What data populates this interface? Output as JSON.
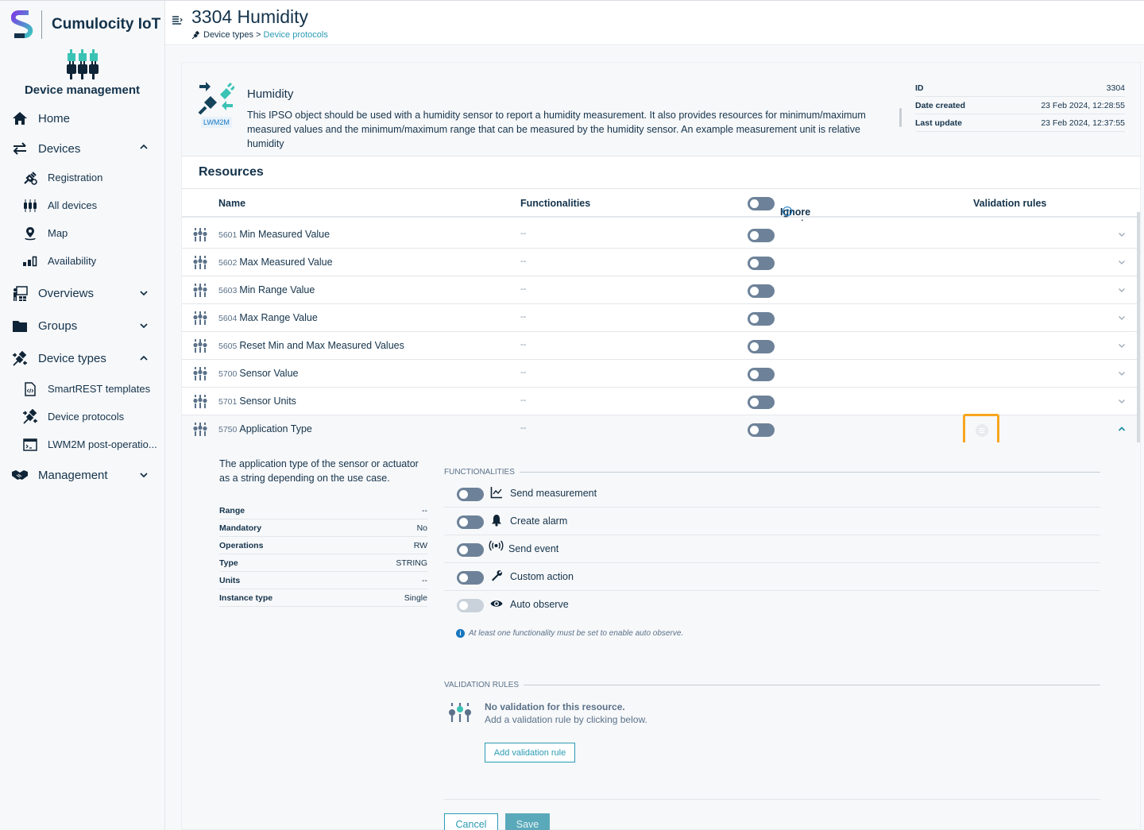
{
  "brand": {
    "name": "Cumulocity IoT",
    "app_name": "Device management"
  },
  "sidebar": {
    "items": [
      {
        "label": "Home",
        "icon": "home-icon"
      },
      {
        "label": "Devices",
        "icon": "devices-arrows-icon",
        "expanded": true,
        "children": [
          {
            "label": "Registration",
            "icon": "plug-add-icon"
          },
          {
            "label": "All devices",
            "icon": "all-devices-icon"
          },
          {
            "label": "Map",
            "icon": "map-pin-icon"
          },
          {
            "label": "Availability",
            "icon": "bars-icon"
          }
        ]
      },
      {
        "label": "Overviews",
        "icon": "presentation-icon",
        "expanded": false
      },
      {
        "label": "Groups",
        "icon": "folder-icon",
        "expanded": false
      },
      {
        "label": "Device types",
        "icon": "plugs-icon",
        "expanded": true,
        "children": [
          {
            "label": "SmartREST templates",
            "icon": "code-file-icon"
          },
          {
            "label": "Device protocols",
            "icon": "plugs-icon"
          },
          {
            "label": "LWM2M post-operatio...",
            "icon": "terminal-icon"
          }
        ]
      },
      {
        "label": "Management",
        "icon": "handshake-icon",
        "expanded": false
      }
    ]
  },
  "header": {
    "title": "3304 Humidity",
    "breadcrumb": {
      "parent": "Device types",
      "separator": ">",
      "current": "Device protocols"
    }
  },
  "object": {
    "name": "Humidity",
    "badge": "LWM2M",
    "description": "This IPSO object should be used with a humidity sensor to report a humidity measurement.  It also provides resources for minimum/maximum measured values and the minimum/maximum range that can be measured by the humidity sensor. An example measurement unit is relative humidity",
    "meta": [
      {
        "key": "ID",
        "value": "3304"
      },
      {
        "key": "Date created",
        "value": "23 Feb 2024, 12:28:55"
      },
      {
        "key": "Last update",
        "value": "23 Feb 2024, 12:37:55"
      }
    ]
  },
  "resources": {
    "title": "Resources",
    "columns": {
      "name": "Name",
      "functionalities": "Functionalities",
      "ignore_empty": "Ignore empty values",
      "validation": "Validation rules"
    },
    "ignore_empty_all": false,
    "rows": [
      {
        "id": "5601",
        "name": "Min Measured Value",
        "functionalities": "--",
        "ignore_empty": false
      },
      {
        "id": "5602",
        "name": "Max Measured Value",
        "functionalities": "--",
        "ignore_empty": false
      },
      {
        "id": "5603",
        "name": "Min Range Value",
        "functionalities": "--",
        "ignore_empty": false
      },
      {
        "id": "5604",
        "name": "Max Range Value",
        "functionalities": "--",
        "ignore_empty": false
      },
      {
        "id": "5605",
        "name": "Reset Min and Max Measured Values",
        "functionalities": "--",
        "ignore_empty": false
      },
      {
        "id": "5700",
        "name": "Sensor Value",
        "functionalities": "--",
        "ignore_empty": false
      },
      {
        "id": "5701",
        "name": "Sensor Units",
        "functionalities": "--",
        "ignore_empty": false
      },
      {
        "id": "5750",
        "name": "Application Type",
        "functionalities": "--",
        "ignore_empty": false,
        "expanded": true
      }
    ]
  },
  "detail": {
    "description": "The application type of the sensor or actuator as a string depending on the use case.",
    "properties": [
      {
        "key": "Range",
        "value": "--"
      },
      {
        "key": "Mandatory",
        "value": "No"
      },
      {
        "key": "Operations",
        "value": "RW"
      },
      {
        "key": "Type",
        "value": "STRING"
      },
      {
        "key": "Units",
        "value": "--"
      },
      {
        "key": "Instance type",
        "value": "Single"
      }
    ],
    "functionalities_label": "FUNCTIONALITIES",
    "functionalities": [
      {
        "label": "Send measurement",
        "icon": "line-chart-icon",
        "enabled": false
      },
      {
        "label": "Create alarm",
        "icon": "bell-icon",
        "enabled": false
      },
      {
        "label": "Send event",
        "icon": "broadcast-icon",
        "enabled": false
      },
      {
        "label": "Custom action",
        "icon": "wrench-icon",
        "enabled": false
      },
      {
        "label": "Auto observe",
        "icon": "eye-icon",
        "enabled": false,
        "disabled": true
      }
    ],
    "note": "At least one functionality must be set to enable auto observe.",
    "validation_label": "VALIDATION RULES",
    "no_validation_title": "No validation for this resource.",
    "no_validation_hint": "Add a validation rule by clicking below.",
    "add_rule_label": "Add validation rule",
    "cancel_label": "Cancel",
    "save_label": "Save"
  }
}
